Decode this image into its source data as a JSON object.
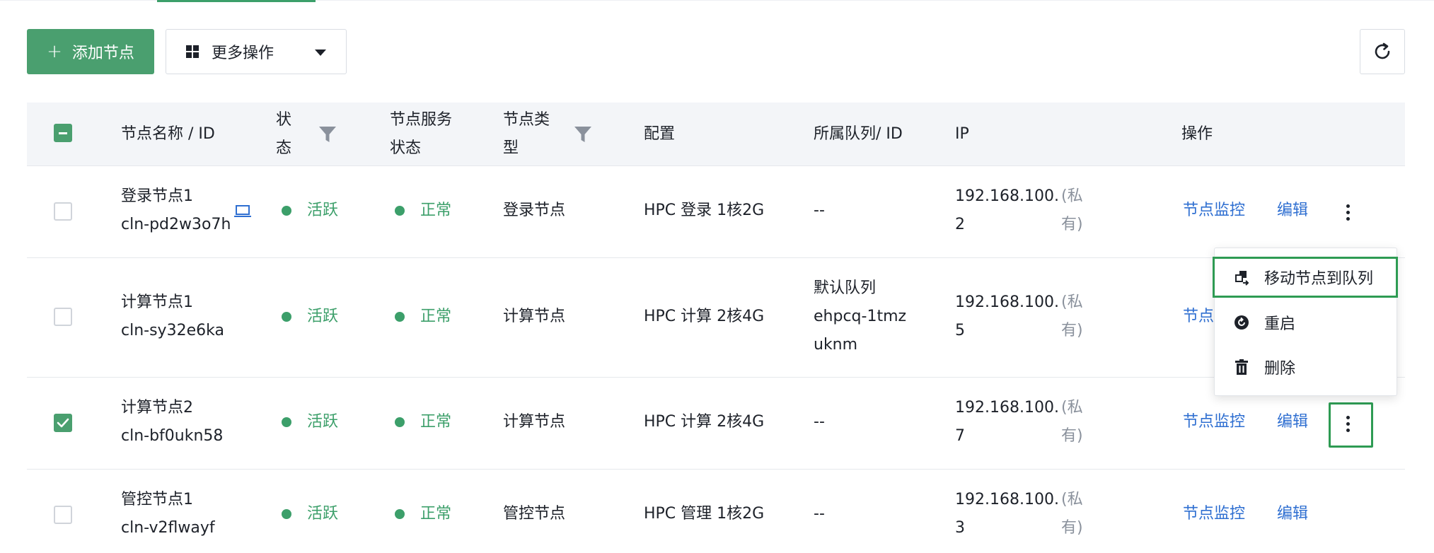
{
  "toolbar": {
    "add_label": "添加节点",
    "more_label": "更多操作"
  },
  "table": {
    "headers": {
      "name": "节点名称 / ID",
      "status_l1": "状",
      "status_l2": "态",
      "service_l1": "节点服务",
      "service_l2": "状态",
      "type_l1": "节点类",
      "type_l2": "型",
      "config": "配置",
      "queue": "所属队列/ ID",
      "ip": "IP",
      "actions": "操作"
    },
    "rows": [
      {
        "name": "登录节点1",
        "id": "cln-pd2w3o7h",
        "status": "活跃",
        "service": "正常",
        "type": "登录节点",
        "config": "HPC 登录 1核2G",
        "queue_name": "--",
        "queue_id_l1": "",
        "queue_id_l2": "",
        "ip_l1": "192.168.100.",
        "ip_l2": "2",
        "ip_tag_l1": "(私",
        "ip_tag_l2": "有)",
        "monitor": "节点监控",
        "edit": "编辑",
        "checked": false
      },
      {
        "name": "计算节点1",
        "id": "cln-sy32e6ka",
        "status": "活跃",
        "service": "正常",
        "type": "计算节点",
        "config": "HPC 计算 2核4G",
        "queue_name": "默认队列",
        "queue_id_l1": "ehpcq-1tmz",
        "queue_id_l2": "uknm",
        "ip_l1": "192.168.100.",
        "ip_l2": "5",
        "ip_tag_l1": "(私",
        "ip_tag_l2": "有)",
        "monitor": "节点",
        "edit": "",
        "checked": false
      },
      {
        "name": "计算节点2",
        "id": "cln-bf0ukn58",
        "status": "活跃",
        "service": "正常",
        "type": "计算节点",
        "config": "HPC 计算 2核4G",
        "queue_name": "--",
        "queue_id_l1": "",
        "queue_id_l2": "",
        "ip_l1": "192.168.100.",
        "ip_l2": "7",
        "ip_tag_l1": "(私",
        "ip_tag_l2": "有)",
        "monitor": "节点监控",
        "edit": "编辑",
        "checked": true
      },
      {
        "name": "管控节点1",
        "id": "cln-v2flwayf",
        "status": "活跃",
        "service": "正常",
        "type": "管控节点",
        "config": "HPC 管理 1核2G",
        "queue_name": "--",
        "queue_id_l1": "",
        "queue_id_l2": "",
        "ip_l1": "192.168.100.",
        "ip_l2": "3",
        "ip_tag_l1": "(私",
        "ip_tag_l2": "有)",
        "monitor": "节点监控",
        "edit": "编辑",
        "checked": false
      }
    ]
  },
  "menu": {
    "move": "移动节点到队列",
    "restart": "重启",
    "delete": "删除"
  },
  "colors": {
    "primary": "#4a9f6f",
    "link": "#2f6fd1",
    "highlight": "#2e9b53"
  }
}
